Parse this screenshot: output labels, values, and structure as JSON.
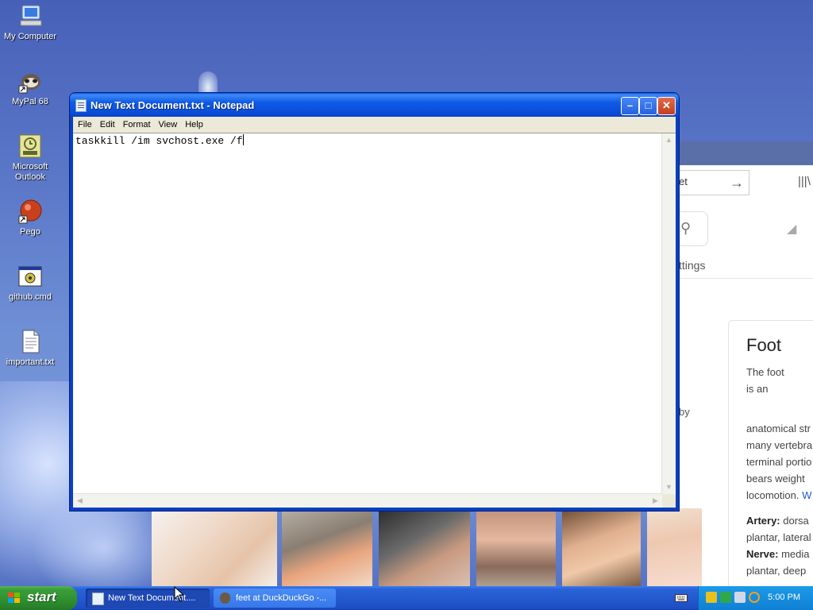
{
  "desktop": {
    "icons": [
      {
        "label": "My Computer",
        "icon": "my-computer-icon"
      },
      {
        "label": "MyPal 68",
        "icon": "mypal-icon"
      },
      {
        "label": "Microsoft Outlook",
        "icon": "outlook-icon"
      },
      {
        "label": "Pego",
        "icon": "pego-icon"
      },
      {
        "label": "github.cmd",
        "icon": "cmd-icon"
      },
      {
        "label": "important.txt",
        "icon": "text-file-icon"
      }
    ]
  },
  "notepad": {
    "title": "New Text Document.txt - Notepad",
    "menu": [
      "File",
      "Edit",
      "Format",
      "View",
      "Help"
    ],
    "content": "taskkill /im svchost.exe /f"
  },
  "browser": {
    "url_fragment": "et",
    "settings_fragment": "ttings",
    "by_fragment": "by",
    "panel": {
      "title": "Foot",
      "intro": "The foot\nis an",
      "body": "anatomical str\nmany vertebra\nterminal portio\nbears weight \nlocomotion. ",
      "link": "W",
      "artery_label": "Artery:",
      "artery_text": " dorsa\nplantar, lateral",
      "nerve_label": "Nerve:",
      "nerve_text": " media\nplantar, deep"
    }
  },
  "taskbar": {
    "start_label": "start",
    "items": [
      {
        "label": "New Text Document....",
        "icon": "notepad-icon",
        "active": true
      },
      {
        "label": "feet at DuckDuckGo -...",
        "icon": "mypal-icon",
        "active": false
      }
    ],
    "clock": "5:00 PM"
  },
  "colors": {
    "xp_blue": "#0a54e8",
    "start_green": "#3a9d3a",
    "tray_blue": "#0f80d4",
    "link_blue": "#1a5bd6"
  }
}
